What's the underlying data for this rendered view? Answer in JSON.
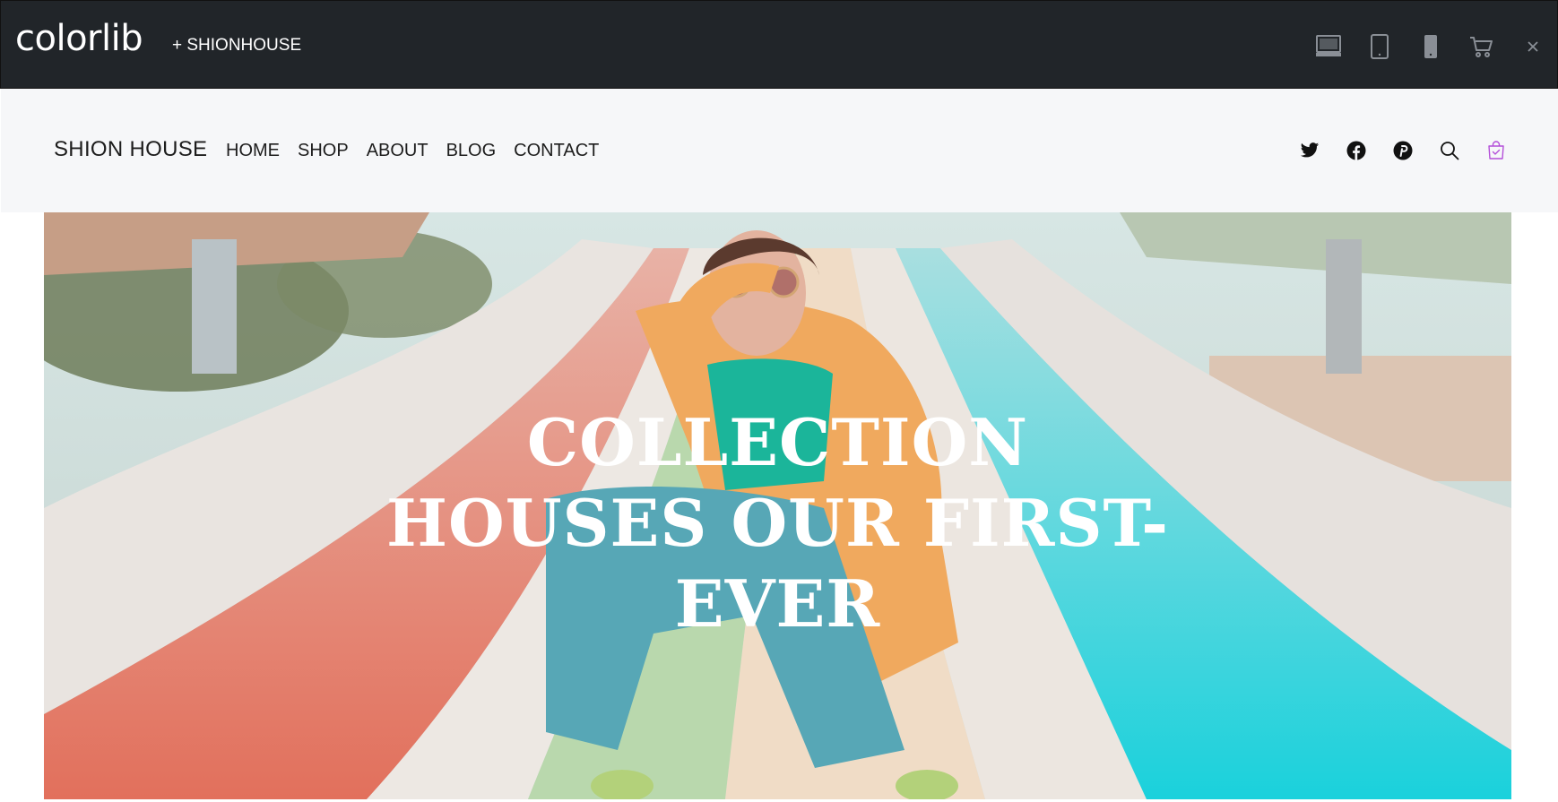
{
  "topbar": {
    "brand": "colorlib",
    "theme_name": "+ SHIONHOUSE",
    "icons": [
      "desktop-icon",
      "tablet-icon",
      "mobile-icon",
      "cart-icon",
      "close-icon"
    ]
  },
  "header": {
    "logo": "SHION HOUSE",
    "nav": [
      "HOME",
      "SHOP",
      "ABOUT",
      "BLOG",
      "CONTACT"
    ],
    "social_icons": [
      "twitter-icon",
      "facebook-icon",
      "pinterest-icon",
      "search-icon",
      "shopping-bag-icon"
    ],
    "accent_color": "#b44fd9"
  },
  "hero": {
    "title_lines": [
      "COLLECTION",
      "HOUSES OUR FIRST-",
      "EVER"
    ]
  }
}
